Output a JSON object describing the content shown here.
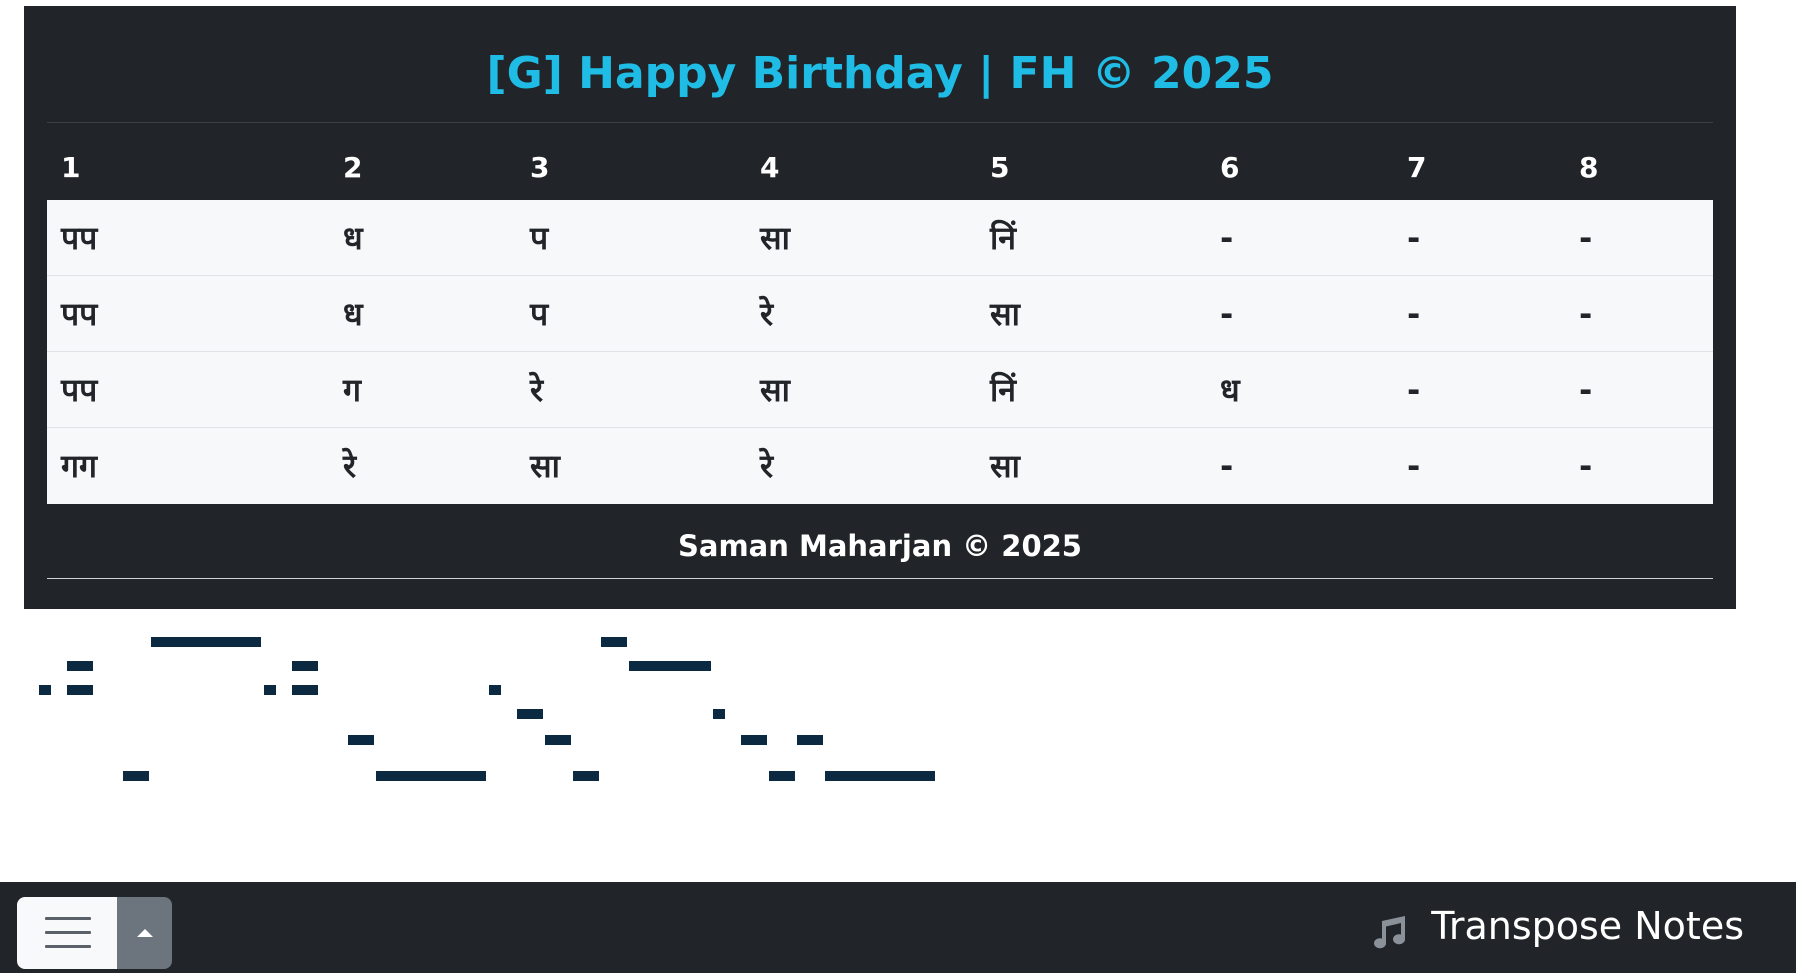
{
  "header": {
    "title": "[G] Happy Birthday | FH © 2025"
  },
  "table": {
    "columns": [
      "1",
      "2",
      "3",
      "4",
      "5",
      "6",
      "7",
      "8"
    ],
    "rows": [
      [
        "पप",
        "ध",
        "प",
        "सा",
        "निं",
        "-",
        "-",
        "-"
      ],
      [
        "पप",
        "ध",
        "प",
        "रे",
        "सा",
        "-",
        "-",
        "-"
      ],
      [
        "पप",
        "ग",
        "रे",
        "सा",
        "निं",
        "ध",
        "-",
        "-"
      ],
      [
        "गग",
        "रे",
        "सा",
        "रे",
        "सा",
        "-",
        "-",
        "-"
      ]
    ]
  },
  "footer": {
    "credit": "Saman Maharjan © 2025"
  },
  "pitch_graph": {
    "bar_color": "#0b2a41"
  },
  "bottom_bar": {
    "menu_icon": "hamburger-icon",
    "dropup_icon": "caret-up-icon",
    "transpose_icon": "music-note-icon",
    "transpose_label": "Transpose Notes"
  },
  "colors": {
    "title": "#1fbde6",
    "panel": "#212529",
    "caret_button": "#6c757d"
  }
}
